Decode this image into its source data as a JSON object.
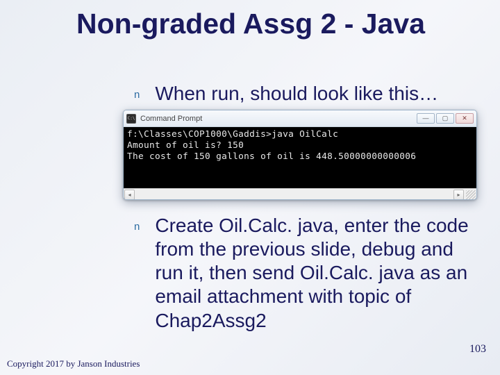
{
  "title": "Non-graded Assg 2 - Java",
  "bullets": {
    "marker": "n",
    "item1": "When run, should look like this…",
    "item2": "Create Oil.Calc. java, enter the code from the previous slide, debug and run it, then send Oil.Calc. java as an email attachment with topic of Chap2Assg2"
  },
  "console": {
    "icon_label": "cmd",
    "window_title": "Command Prompt",
    "lines": [
      "f:\\Classes\\COP1000\\Gaddis>java OilCalc",
      "Amount of oil is? 150",
      "The cost of 150 gallons of oil is 448.50000000000006"
    ],
    "controls": {
      "minimize": "min",
      "maximize": "max",
      "close": "close"
    },
    "scroll": {
      "left": "left-arrow",
      "right": "right-arrow",
      "resize": "resize-grip"
    }
  },
  "footer": {
    "copyright": "Copyright 2017 by Janson Industries",
    "slide_number": "103"
  }
}
